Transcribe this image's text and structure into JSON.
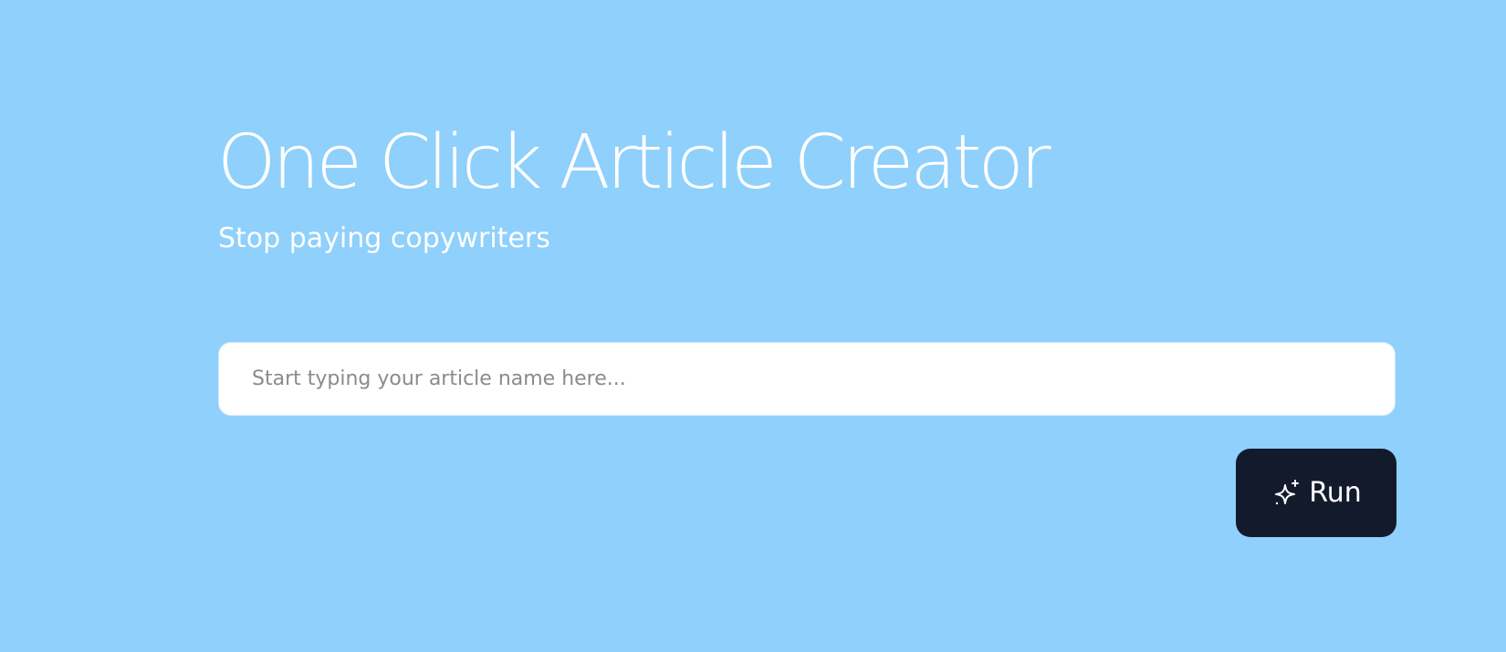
{
  "header": {
    "title": "One Click Article Creator",
    "subtitle": "Stop paying copywriters"
  },
  "article_input": {
    "value": "",
    "placeholder": "Start typing your article name here..."
  },
  "run_button": {
    "label": "Run",
    "icon": "sparkles-icon"
  },
  "colors": {
    "background": "#8fd0fc",
    "input_background": "#ffffff",
    "button_background": "#131a2c",
    "text": "#ffffff"
  }
}
